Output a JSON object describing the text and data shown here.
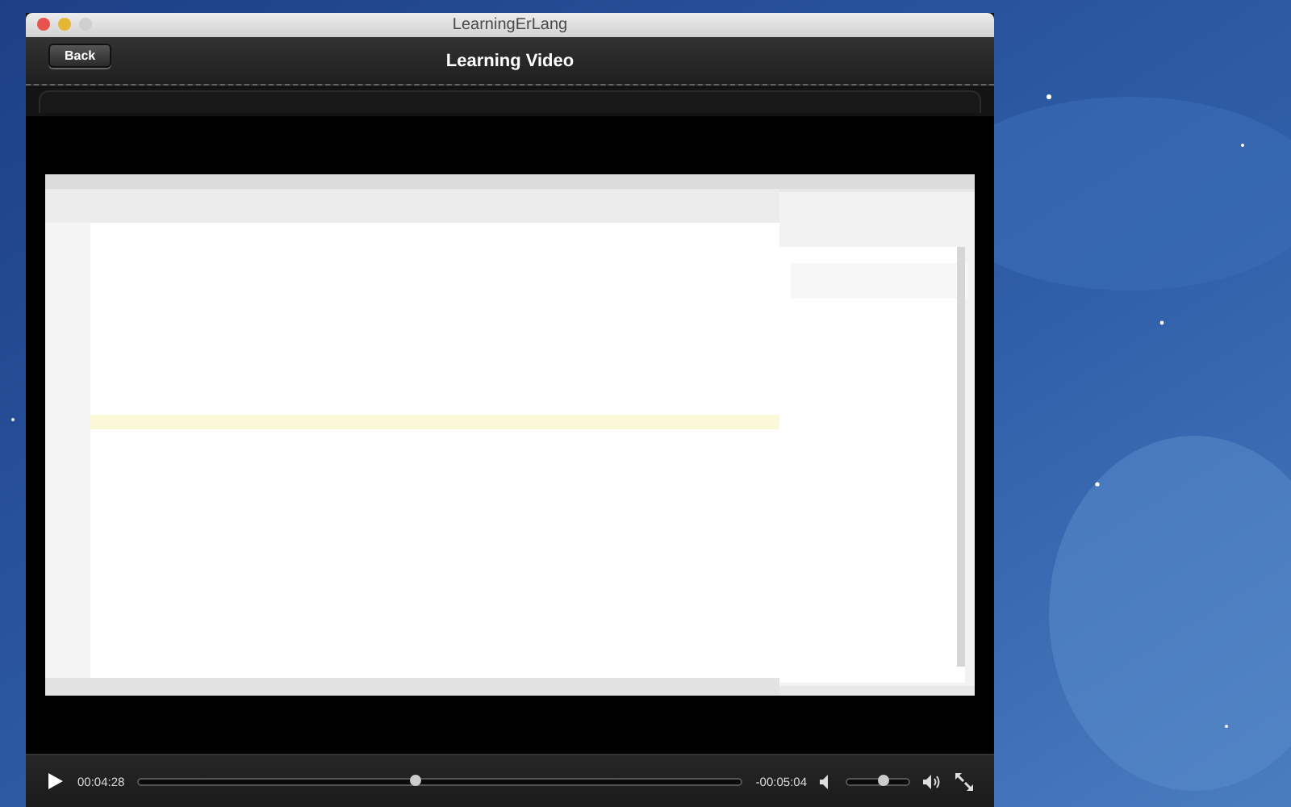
{
  "window": {
    "title": "LearningErLang"
  },
  "header": {
    "back_button": "Back",
    "title": "Learning Video"
  },
  "player": {
    "playing": false,
    "elapsed": "00:04:28",
    "level": 0.46,
    "remaining": "-00:05:04",
    "volume": {
      "level": 0.58
    }
  }
}
